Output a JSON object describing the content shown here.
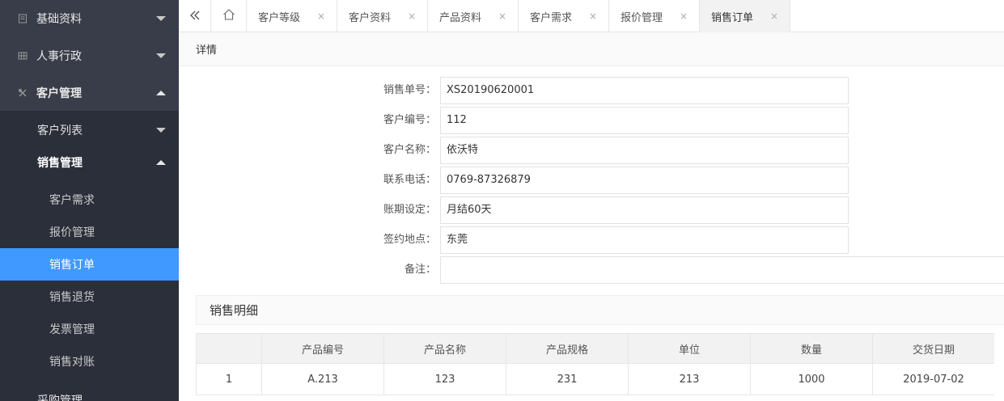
{
  "sidebar": {
    "top_items": [
      {
        "label": "基础资料",
        "icon": "doc-icon",
        "expanded": false
      },
      {
        "label": "人事行政",
        "icon": "grid-icon",
        "expanded": false
      },
      {
        "label": "客户管理",
        "icon": "tools-icon",
        "expanded": true
      }
    ],
    "sub_items": [
      {
        "label": "客户列表",
        "expanded": false
      },
      {
        "label": "销售管理",
        "expanded": true
      }
    ],
    "sub2_items": [
      {
        "label": "客户需求"
      },
      {
        "label": "报价管理"
      },
      {
        "label": "销售订单",
        "active": true
      },
      {
        "label": "销售退货"
      },
      {
        "label": "发票管理"
      },
      {
        "label": "销售对账"
      }
    ],
    "cut_item": "采购管理"
  },
  "tabbar": {
    "tabs": [
      {
        "label": "客户等级"
      },
      {
        "label": "客户资料"
      },
      {
        "label": "产品资料"
      },
      {
        "label": "客户需求"
      },
      {
        "label": "报价管理"
      },
      {
        "label": "销售订单",
        "active": true
      }
    ],
    "close_glyph": "×"
  },
  "detail_header": "详情",
  "form": {
    "fields": [
      {
        "label": "销售单号：",
        "value": "XS20190620001"
      },
      {
        "label": "客户编号：",
        "value": "112"
      },
      {
        "label": "客户名称：",
        "value": "依沃特"
      },
      {
        "label": "联系电话：",
        "value": "0769-87326879"
      },
      {
        "label": "账期设定：",
        "value": "月结60天"
      },
      {
        "label": "签约地点：",
        "value": "东莞"
      },
      {
        "label": "备注：",
        "value": ""
      }
    ]
  },
  "sales_detail": {
    "title": "销售明细",
    "columns": [
      "",
      "产品编号",
      "产品名称",
      "产品规格",
      "单位",
      "数量",
      "交货日期"
    ],
    "rows": [
      [
        "1",
        "A.213",
        "123",
        "231",
        "213",
        "1000",
        "2019-07-02"
      ]
    ]
  },
  "colors": {
    "sidebar_bg": "#393d49",
    "sub_bg": "#2b2f3a",
    "active": "#4099ff"
  }
}
